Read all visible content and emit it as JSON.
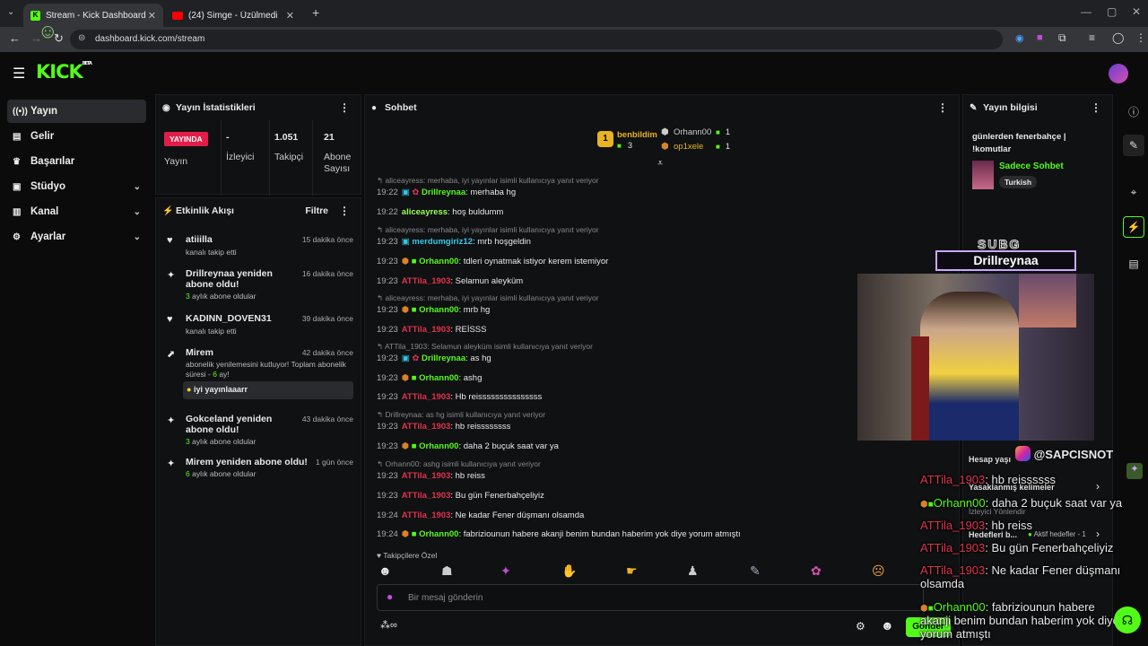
{
  "browser": {
    "tabs": [
      {
        "title": "Stream - Kick Dashboard"
      },
      {
        "title": "(24) Simge - Üzülmedin mi"
      }
    ],
    "url": "dashboard.kick.com/stream"
  },
  "brand": {
    "logo": "KICK",
    "beta": "BETA"
  },
  "sidebar": {
    "items": [
      {
        "label": "Yayın",
        "icon": "broadcast-icon"
      },
      {
        "label": "Gelir",
        "icon": "revenue-icon"
      },
      {
        "label": "Başarılar",
        "icon": "trophy-icon"
      },
      {
        "label": "Stüdyo",
        "icon": "studio-icon"
      },
      {
        "label": "Kanal",
        "icon": "channel-icon"
      },
      {
        "label": "Ayarlar",
        "icon": "settings-icon"
      }
    ]
  },
  "stats": {
    "title": "Yayın İstatistikleri",
    "status": "YAYINDA",
    "status_label": "Yayın",
    "viewers_value": "-",
    "viewers_label": "İzleyici",
    "followers_value": "1.051",
    "followers_label": "Takipçi",
    "subs_value": "21",
    "subs_label": "Abone Sayısı"
  },
  "activity": {
    "title": "Etkinlik Akışı",
    "filter": "Filtre",
    "events": [
      {
        "name": "atiiilla",
        "sub": "kanalı takip etti",
        "time": "15 dakika önce"
      },
      {
        "name": "Drillreynaa yeniden abone oldu!",
        "sub_num": "3",
        "sub_rest": " aylık abone oldular",
        "time": "16 dakika önce"
      },
      {
        "name": "KADINN_DOVEN31",
        "sub": "kanalı takip etti",
        "time": "39 dakika önce"
      },
      {
        "name": "Mirem",
        "sub_a": "abonelik yenilemesini kutluyor! Toplam abonelik süresi - ",
        "sub_num": "6",
        "sub_b": " ay!",
        "quote": "iyi yayınlaaarr",
        "time": "42 dakika önce"
      },
      {
        "name": "Gokceland yeniden abone oldu!",
        "sub_num": "3",
        "sub_rest": " aylık abone oldular",
        "time": "43 dakika önce"
      },
      {
        "name": "Mirem yeniden abone oldu!",
        "sub_num": "6",
        "sub_rest": " aylık abone oldular",
        "time": "1 gün önce"
      }
    ]
  },
  "chat": {
    "title": "Sohbet",
    "leaderboard": [
      {
        "rank": "1",
        "name": "benbildim",
        "count": "3"
      },
      {
        "name": "Orhann00",
        "count": "1"
      },
      {
        "name": "op1xele",
        "count": "1"
      }
    ],
    "lines": [
      {
        "reply": "aliceayress: merhaba, iyi yayınlar isimli kullanıcıya yanıt veriyor"
      },
      {
        "time": "19:22",
        "user": "Drillreynaa",
        "text": ": merhaba hg",
        "color": "green"
      },
      {
        "time": "19:22",
        "user": "aliceayress",
        "text": ": hoş buldumm",
        "color": "lime"
      },
      {
        "reply": "aliceayress: merhaba, iyi yayınlar isimli kullanıcıya yanıt veriyor"
      },
      {
        "time": "19:23",
        "user": "merdumgiriz12",
        "text": ": mrb hoşgeldin",
        "color": "cyan"
      },
      {
        "time": "19:23",
        "user": "Orhann00",
        "text": ": tdleri oynatmak istiyor kerem istemiyor",
        "color": "green"
      },
      {
        "time": "19:23",
        "user": "ATTila_1903",
        "text": ": Selamun aleyküm",
        "color": "red"
      },
      {
        "reply": "aliceayress: merhaba, iyi yayınlar isimli kullanıcıya yanıt veriyor"
      },
      {
        "time": "19:23",
        "user": "Orhann00",
        "text": ": mrb hg",
        "color": "green"
      },
      {
        "time": "19:23",
        "user": "ATTila_1903",
        "text": ": REİSSS",
        "color": "red"
      },
      {
        "reply": "ATTila_1903: Selamun aleyküm isimli kullanıcıya yanıt veriyor"
      },
      {
        "time": "19:23",
        "user": "Drillreynaa",
        "text": ": as hg",
        "color": "green"
      },
      {
        "time": "19:23",
        "user": "Orhann00",
        "text": ": ashg",
        "color": "green"
      },
      {
        "time": "19:23",
        "user": "ATTila_1903",
        "text": ": Hb reisssssssssssssss",
        "color": "red"
      },
      {
        "reply": "Drillreynaa: as hg isimli kullanıcıya yanıt veriyor"
      },
      {
        "time": "19:23",
        "user": "ATTila_1903",
        "text": ": hb reissssssss",
        "color": "red"
      },
      {
        "time": "19:23",
        "user": "Orhann00",
        "text": ": daha 2 buçuk saat var ya",
        "color": "green"
      },
      {
        "reply": "Orhann00: ashg isimli kullanıcıya yanıt veriyor"
      },
      {
        "time": "19:23",
        "user": "ATTila_1903",
        "text": ": hb reiss",
        "color": "red"
      },
      {
        "time": "19:23",
        "user": "ATTila_1903",
        "text": ": Bu gün Fenerbahçeliyiz",
        "color": "red"
      },
      {
        "time": "19:24",
        "user": "ATTila_1903",
        "text": ": Ne kadar Fener düşmanı olsamda",
        "color": "red"
      },
      {
        "time": "19:24",
        "user": "Orhann00",
        "text": ": fabriziounun habere akanji benim bundan haberim yok diye yorum atmıştı",
        "color": "green"
      }
    ],
    "emote_label": "Takipçilere Özel",
    "placeholder": "Bir mesaj gönderin",
    "send": "Gönder"
  },
  "stream_info": {
    "title": "Yayın bilgisi",
    "stream_title": "günlerden fenerbahçe | !komutlar",
    "category": "Sadece Sohbet",
    "tag": "Turkish"
  },
  "overlay": {
    "sub_label": "SUBG",
    "sub_name": "Drillreynaa",
    "instagram": "@SAPCISNOT",
    "hidden_1": "Hesap yaşı",
    "hidden_2": "Yasaklanmış kelimeler",
    "hidden_3": "İzleyici Yönlendir",
    "hidden_4": "Hedefleri b...",
    "hidden_5": "Aktif hedefler - 1",
    "chat": [
      {
        "user": "ATTila_1903",
        "text": ": hb reissssss",
        "color": "red"
      },
      {
        "user": "Orhann00",
        "text": ": daha 2 buçuk saat var ya",
        "color": "green"
      },
      {
        "user": "ATTila_1903",
        "text": ": hb reiss",
        "color": "red"
      },
      {
        "user": "ATTila_1903",
        "text": ": Bu gün Fenerbahçeliyiz",
        "color": "red"
      },
      {
        "user": "ATTila_1903",
        "text": ": Ne kadar Fener düşmanı",
        "cont": "olsamda",
        "color": "red"
      },
      {
        "user": "Orhann00",
        "text": ": fabriziounun habere",
        "cont": "akanji benim bundan haberim yok diye",
        "cont2": "yorum atmıştı",
        "color": "green"
      }
    ]
  },
  "colors": {
    "accent": "#53fc18",
    "live": "#e11d48",
    "red_user": "#e0334a"
  }
}
